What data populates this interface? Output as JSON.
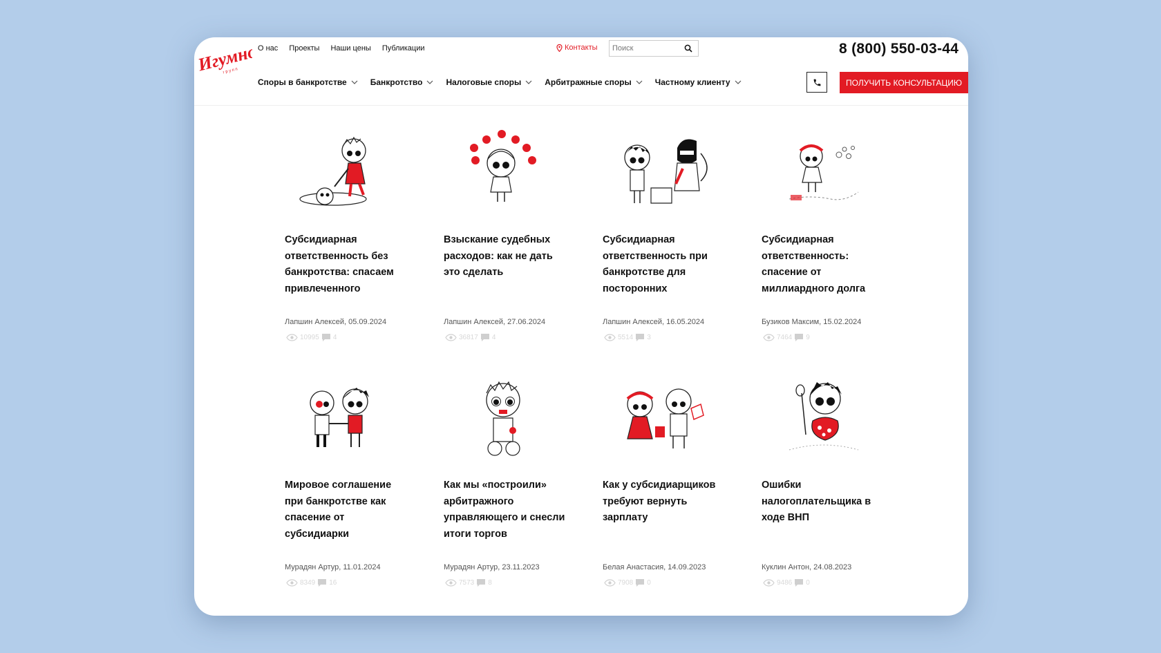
{
  "header": {
    "nav": [
      "О нас",
      "Проекты",
      "Наши цены",
      "Публикации"
    ],
    "contacts": "Контакты",
    "search_placeholder": "Поиск",
    "phone": "8 (800) 550-03-44",
    "main_nav": [
      "Споры в банкротстве",
      "Банкротство",
      "Налоговые споры",
      "Арбитражные споры",
      "Частному клиенту"
    ],
    "consult_label": "ПОЛУЧИТЬ КОНСУЛЬТАЦИЮ"
  },
  "colors": {
    "brand_red": "#e21b24",
    "text": "#111111",
    "background": "#b3cdea"
  },
  "cards": [
    {
      "title": "Субсидиарная ответственность без банкротства: спасаем привлеченного",
      "meta": "Лапшин Алексей, 05.09.2024",
      "views": "10995",
      "comments": "4"
    },
    {
      "title": "Взыскание судебных расходов: как не дать это сделать",
      "meta": "Лапшин Алексей, 27.06.2024",
      "views": "36817",
      "comments": "4"
    },
    {
      "title": "Субсидиарная ответственность при банкротстве для посторонних",
      "meta": "Лапшин Алексей, 16.05.2024",
      "views": "5514",
      "comments": "3"
    },
    {
      "title": "Субсидиарная ответственность: спасение от миллиардного долга",
      "meta": "Бузиков Максим, 15.02.2024",
      "views": "7464",
      "comments": "9"
    },
    {
      "title": "Мировое соглашение при банкротстве как спасение от субсидиарки",
      "meta": "Мурадян Артур, 11.01.2024",
      "views": "8349",
      "comments": "16"
    },
    {
      "title": "Как мы «построили» арбитражного управляющего и снесли итоги торгов",
      "meta": "Мурадян Артур, 23.11.2023",
      "views": "7573",
      "comments": "8"
    },
    {
      "title": "Как у субсидиарщиков требуют вернуть зарплату",
      "meta": "Белая Анастасия, 14.09.2023",
      "views": "7908",
      "comments": "0"
    },
    {
      "title": "Ошибки налогоплательщика в ходе ВНП",
      "meta": "Куклин Антон, 24.08.2023",
      "views": "9486",
      "comments": "0"
    }
  ]
}
